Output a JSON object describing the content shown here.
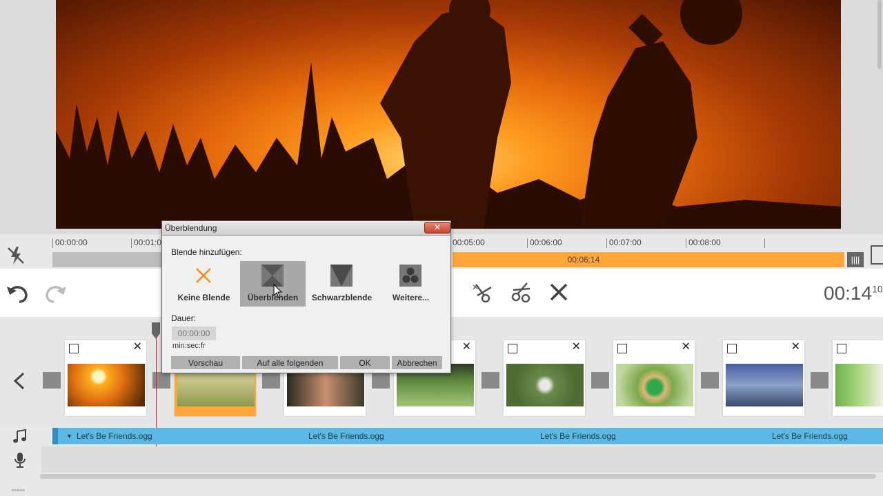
{
  "ruler": {
    "ticks": [
      "00:00:00",
      "00:01:0",
      "00:05:00",
      "00:06:00",
      "00:07:00",
      "00:08:00"
    ],
    "range_time": "00:06:14"
  },
  "toolbar": {
    "time": "00:14",
    "time_frames": "10"
  },
  "dialog": {
    "title": "Überblendung",
    "close": "✕",
    "blend_label": "Blende hinzufügen:",
    "options": [
      {
        "label": "Keine Blende",
        "icon": "x-icon"
      },
      {
        "label": "Überblenden",
        "icon": "crossfade-icon",
        "selected": true
      },
      {
        "label": "Schwarzblende",
        "icon": "fade-to-black-icon"
      },
      {
        "label": "Weitere...",
        "icon": "more-transitions-icon"
      }
    ],
    "duration_label": "Dauer:",
    "duration_placeholder": "00:00:00",
    "duration_unit": "min:sec:fr",
    "buttons": {
      "preview": "Vorschau",
      "apply_all": "Auf alle folgenden",
      "ok": "OK",
      "cancel": "Abbrechen"
    }
  },
  "audio": {
    "track_name": "Let's Be Friends.ogg"
  },
  "colors": {
    "accent": "#ffa53a",
    "audio": "#5cb8e4",
    "playhead": "#e02020"
  }
}
